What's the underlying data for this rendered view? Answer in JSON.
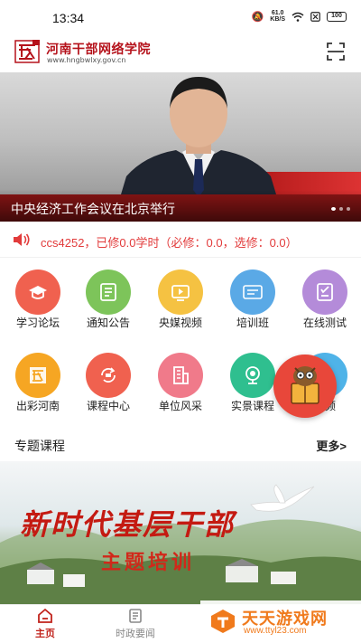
{
  "status_bar": {
    "time": "13:34",
    "net_speed_value": "61.0",
    "net_speed_unit": "KB/S",
    "battery": "100"
  },
  "header": {
    "logo_title": "河南干部网络学院",
    "logo_url": "www.hngbwlxy.gov.cn"
  },
  "banner": {
    "caption": "中央经济工作会议在北京举行",
    "slides": 3,
    "active_slide": 0
  },
  "notice": {
    "text": "ccs4252，已修0.0学时（必修：0.0，选修：0.0）"
  },
  "grid": {
    "items": [
      {
        "label": "学习论坛",
        "icon": "graduation-cap-icon",
        "color": "#f0614f"
      },
      {
        "label": "通知公告",
        "icon": "notice-board-icon",
        "color": "#7dc45a"
      },
      {
        "label": "央媒视频",
        "icon": "video-icon",
        "color": "#f5c242"
      },
      {
        "label": "培训班",
        "icon": "class-icon",
        "color": "#5aa9e6"
      },
      {
        "label": "在线测试",
        "icon": "test-paper-icon",
        "color": "#b48bd9"
      },
      {
        "label": "出彩河南",
        "icon": "henan-seal-icon",
        "color": "#f6a623"
      },
      {
        "label": "课程中心",
        "icon": "course-cycle-icon",
        "color": "#f0614f"
      },
      {
        "label": "单位风采",
        "icon": "building-icon",
        "color": "#f07a8a"
      },
      {
        "label": "实景课程",
        "icon": "camera-icon",
        "color": "#2fbf8f"
      },
      {
        "label": "音频",
        "icon": "audio-icon",
        "color": "#4fb3e8"
      }
    ]
  },
  "section": {
    "title": "专题课程",
    "more": "更多>"
  },
  "promo": {
    "title": "新时代基层干部",
    "subtitle": "主题培训"
  },
  "bottom_nav": {
    "items": [
      {
        "label": "主页",
        "icon": "home-icon",
        "active": true
      },
      {
        "label": "时政要闻",
        "icon": "news-icon",
        "active": false
      }
    ]
  },
  "watermark": {
    "title": "天天游戏网",
    "url": "www.ttyl23.com"
  }
}
